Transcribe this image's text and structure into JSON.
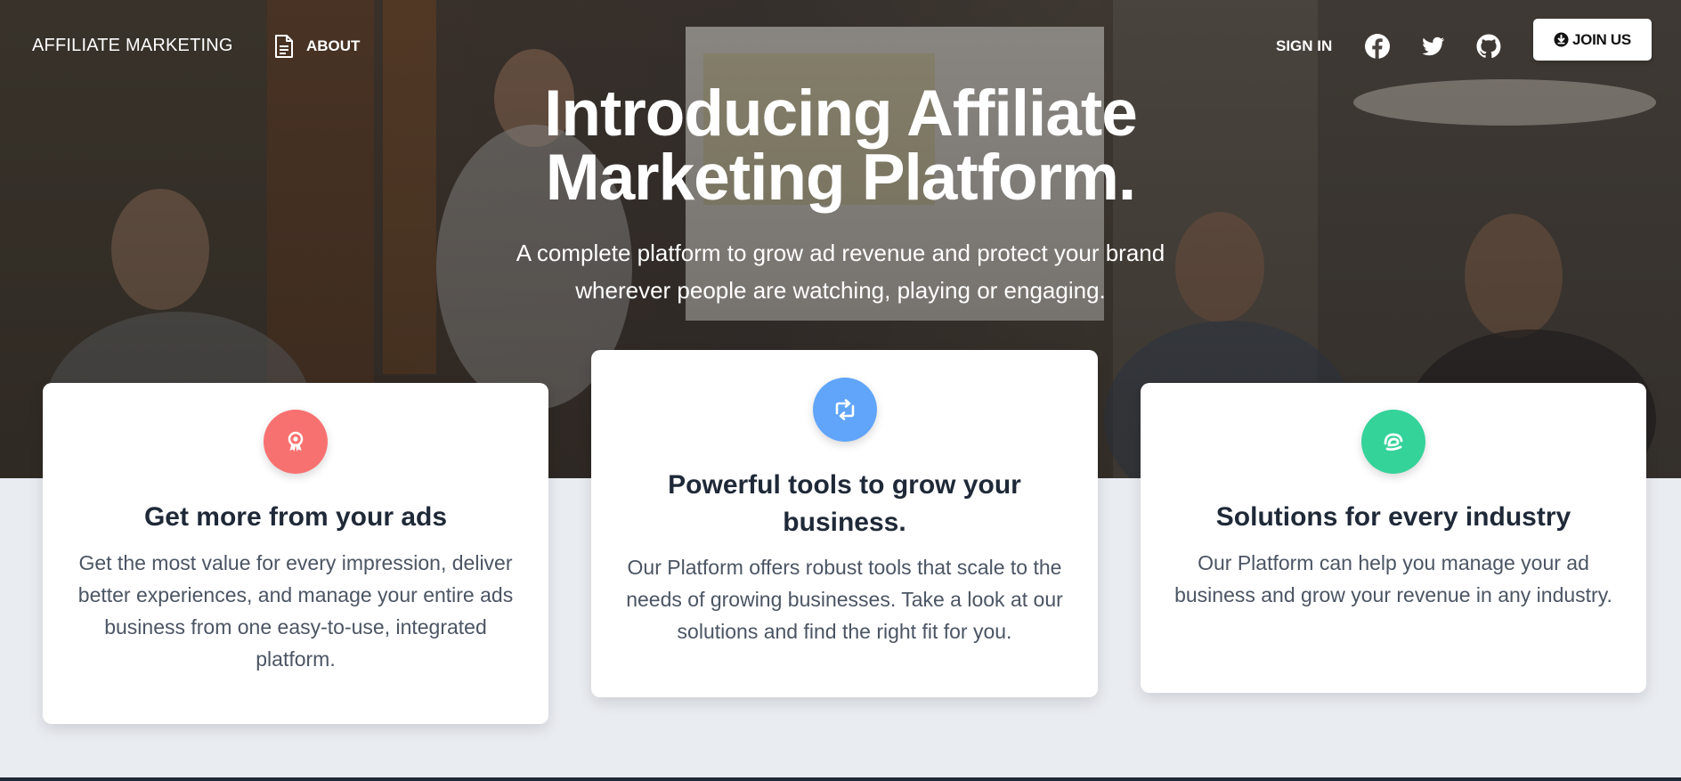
{
  "nav": {
    "brand": "AFFILIATE MARKETING",
    "about": "ABOUT",
    "sign_in": "SIGN IN",
    "join": "JOIN US",
    "social_icons": [
      "facebook-icon",
      "twitter-icon",
      "github-icon"
    ]
  },
  "hero": {
    "title_line1": "Introducing Affiliate",
    "title_line2": "Marketing Platform.",
    "subtitle_line1": "A complete platform to grow ad revenue and protect your brand",
    "subtitle_line2": "wherever people are watching, playing or engaging."
  },
  "cards": [
    {
      "title": "Get more from your ads",
      "text": "Get the most value for every impression, deliver better experiences, and manage your entire ads business from one easy-to-use, integrated platform.",
      "icon": "award-icon",
      "color": "#f87171"
    },
    {
      "title": "Powerful tools to grow your business.",
      "text": "Our Platform offers robust tools that scale to the needs of growing businesses. Take a look at our solutions and find the right fit for you.",
      "icon": "retweet-icon",
      "color": "#60a5fa"
    },
    {
      "title": "Solutions for every industry",
      "text": "Our Platform can help you manage your ad business and grow your revenue in any industry.",
      "icon": "fingerprint-icon",
      "color": "#34d399"
    }
  ]
}
